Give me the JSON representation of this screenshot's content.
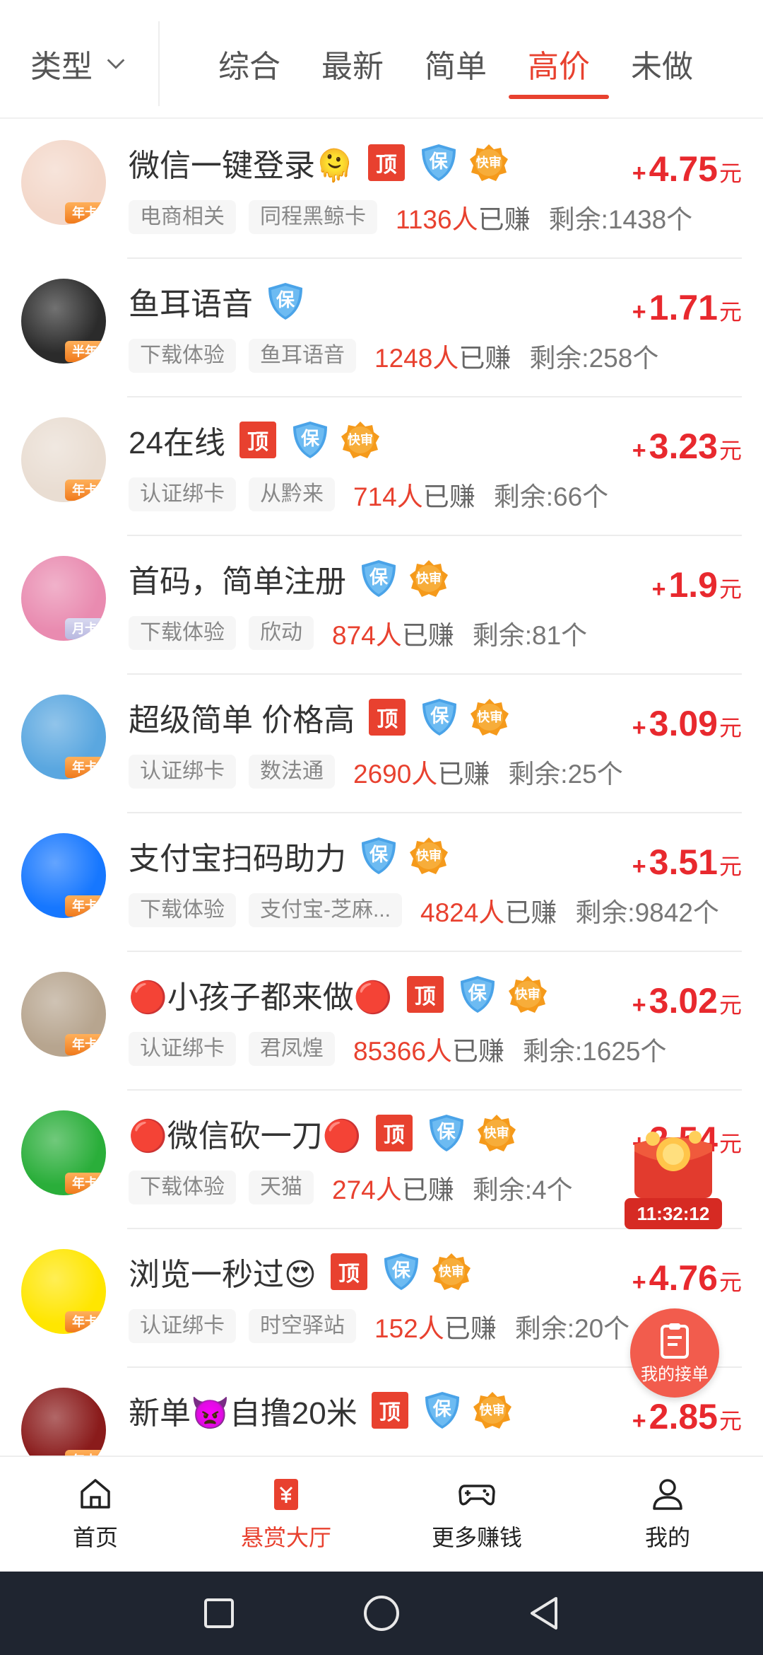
{
  "filter": {
    "type_label": "类型"
  },
  "tabs": [
    {
      "label": "综合",
      "active": false
    },
    {
      "label": "最新",
      "active": false
    },
    {
      "label": "简单",
      "active": false
    },
    {
      "label": "高价",
      "active": true
    },
    {
      "label": "未做",
      "active": false
    }
  ],
  "tasks": [
    {
      "title": "微信一键登录🫠",
      "ding": true,
      "bao": true,
      "kuai": true,
      "badge": "年卡",
      "tag1": "电商相关",
      "tag2": "同程黑鲸卡",
      "earned": "1136人",
      "earned_suffix": "已赚",
      "remaining": "剩余:1438个",
      "price": "4.75",
      "avatar_color": "#f3d7c9"
    },
    {
      "title": "鱼耳语音",
      "ding": false,
      "bao": true,
      "kuai": false,
      "badge": "半年",
      "tag1": "下载体验",
      "tag2": "鱼耳语音",
      "earned": "1248人",
      "earned_suffix": "已赚",
      "remaining": "剩余:258个",
      "price": "1.71",
      "avatar_color": "#2b2b2b"
    },
    {
      "title": "24在线",
      "ding": true,
      "bao": true,
      "kuai": true,
      "badge": "年卡",
      "tag1": "认证绑卡",
      "tag2": "从黔来",
      "earned": "714人",
      "earned_suffix": "已赚",
      "remaining": "剩余:66个",
      "price": "3.23",
      "avatar_color": "#e9ddd2"
    },
    {
      "title": "首码，简单注册",
      "ding": false,
      "bao": true,
      "kuai": true,
      "badge": "月卡",
      "tag1": "下载体验",
      "tag2": "欣动",
      "earned": "874人",
      "earned_suffix": "已赚",
      "remaining": "剩余:81个",
      "price": "1.9",
      "avatar_color": "#e98bb0"
    },
    {
      "title": "超级简单  价格高",
      "ding": true,
      "bao": true,
      "kuai": true,
      "badge": "年卡",
      "tag1": "认证绑卡",
      "tag2": "数法通",
      "earned": "2690人",
      "earned_suffix": "已赚",
      "remaining": "剩余:25个",
      "price": "3.09",
      "avatar_color": "#5aa7e0"
    },
    {
      "title": "支付宝扫码助力",
      "ding": false,
      "bao": true,
      "kuai": true,
      "badge": "年卡",
      "tag1": "下载体验",
      "tag2": "支付宝-芝麻...",
      "earned": "4824人",
      "earned_suffix": "已赚",
      "remaining": "剩余:9842个",
      "price": "3.51",
      "avatar_color": "#1677ff"
    },
    {
      "title": "🔴小孩子都来做🔴",
      "ding": true,
      "bao": true,
      "kuai": true,
      "badge": "年卡",
      "tag1": "认证绑卡",
      "tag2": "君凤煌",
      "earned": "85366人",
      "earned_suffix": "已赚",
      "remaining": "剩余:1625个",
      "price": "3.02",
      "avatar_color": "#b7a58f"
    },
    {
      "title": "🔴微信砍一刀🔴",
      "ding": true,
      "bao": true,
      "kuai": true,
      "badge": "年卡",
      "tag1": "下载体验",
      "tag2": "天猫",
      "earned": "274人",
      "earned_suffix": "已赚",
      "remaining": "剩余:4个",
      "price": "2.54",
      "avatar_color": "#2aae3a"
    },
    {
      "title": "浏览一秒过😍",
      "ding": true,
      "bao": true,
      "kuai": true,
      "badge": "年卡",
      "tag1": "认证绑卡",
      "tag2": "时空驿站",
      "earned": "152人",
      "earned_suffix": "已赚",
      "remaining": "剩余:20个",
      "price": "4.76",
      "avatar_color": "#ffe600"
    },
    {
      "title": "新单👿自撸20米",
      "ding": true,
      "bao": true,
      "kuai": true,
      "badge": "年卡",
      "tag1": "",
      "tag2": "",
      "earned": "",
      "earned_suffix": "",
      "remaining": "",
      "price": "2.85",
      "avatar_color": "#8a1b1b"
    }
  ],
  "labels": {
    "ding": "顶",
    "bao": "保",
    "kuai": "快审",
    "plus": "+",
    "unit": "元"
  },
  "floating": {
    "gift_timer": "11:32:12",
    "orders_label": "我的接单"
  },
  "bottom_nav": [
    {
      "label": "首页",
      "icon": "home-icon",
      "active": false
    },
    {
      "label": "悬赏大厅",
      "icon": "reward-hall-icon",
      "active": true
    },
    {
      "label": "更多赚钱",
      "icon": "gamepad-icon",
      "active": false
    },
    {
      "label": "我的",
      "icon": "profile-icon",
      "active": false
    }
  ],
  "colors": {
    "accent": "#e8412f",
    "price": "#e8292e",
    "bao": "#4aa3e8",
    "kuai": "#f59a1b",
    "sysbar": "#1f2530"
  }
}
